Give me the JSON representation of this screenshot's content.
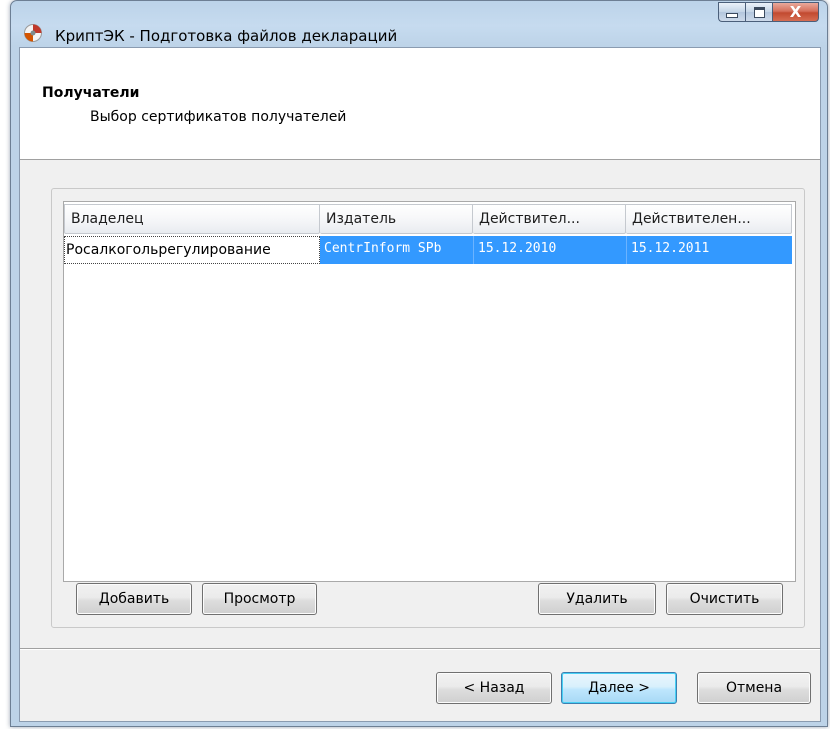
{
  "window": {
    "title": "КриптЭК - Подготовка файлов деклараций",
    "close_glyph": "X",
    "icon": "cryptek-app-icon"
  },
  "header": {
    "title": "Получатели",
    "subtitle": "Выбор сертификатов получателей"
  },
  "table": {
    "columns": [
      "Владелец",
      "Издатель",
      "Действител...",
      "Действителен..."
    ],
    "rows": [
      {
        "owner": "Росалкогольрегулирование",
        "issuer": "CentrInform SPb",
        "valid_from": "15.12.2010",
        "valid_to": "15.12.2011",
        "selected": true
      }
    ]
  },
  "list_buttons": {
    "add": "Добавить",
    "view": "Просмотр",
    "delete": "Удалить",
    "clear": "Очистить"
  },
  "nav_buttons": {
    "back": "< Назад",
    "next": "Далее >",
    "cancel": "Отмена"
  },
  "colors": {
    "selection": "#3399ff",
    "default_button_border": "#3c7fb1"
  }
}
